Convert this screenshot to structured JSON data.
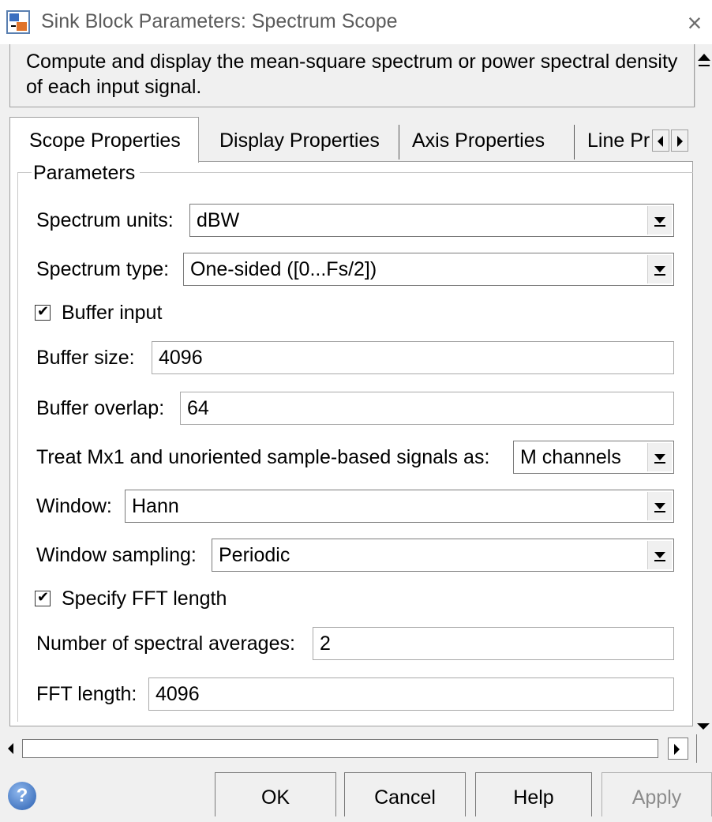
{
  "window": {
    "title": "Sink Block Parameters: Spectrum Scope",
    "close": "×"
  },
  "description": "Compute and display the mean-square spectrum or power spectral density of each input signal.",
  "tabs": [
    {
      "label": "Scope Properties",
      "active": true
    },
    {
      "label": "Display Properties",
      "active": false
    },
    {
      "label": "Axis Properties",
      "active": false
    },
    {
      "label": "Line Pr",
      "active": false
    }
  ],
  "group": {
    "title": "Parameters"
  },
  "fields": {
    "spectrum_units": {
      "label": "Spectrum units:",
      "value": "dBW"
    },
    "spectrum_type": {
      "label": "Spectrum type:",
      "value": "One-sided ([0...Fs/2])"
    },
    "buffer_input": {
      "label": "Buffer input",
      "checked": true
    },
    "buffer_size": {
      "label": "Buffer size:",
      "value": "4096"
    },
    "buffer_overlap": {
      "label": "Buffer overlap:",
      "value": "64"
    },
    "treat_signals": {
      "label": "Treat Mx1 and unoriented sample-based signals as:",
      "value": "M channels"
    },
    "window": {
      "label": "Window:",
      "value": "Hann"
    },
    "window_sampling": {
      "label": "Window sampling:",
      "value": "Periodic"
    },
    "specify_fft": {
      "label": "Specify FFT length",
      "checked": true
    },
    "spectral_averages": {
      "label": "Number of spectral averages:",
      "value": "2"
    },
    "fft_length": {
      "label": "FFT length:",
      "value": "4096"
    }
  },
  "buttons": {
    "ok": "OK",
    "cancel": "Cancel",
    "help": "Help",
    "apply": "Apply"
  },
  "icons": {
    "help": "?",
    "check": "✔"
  }
}
